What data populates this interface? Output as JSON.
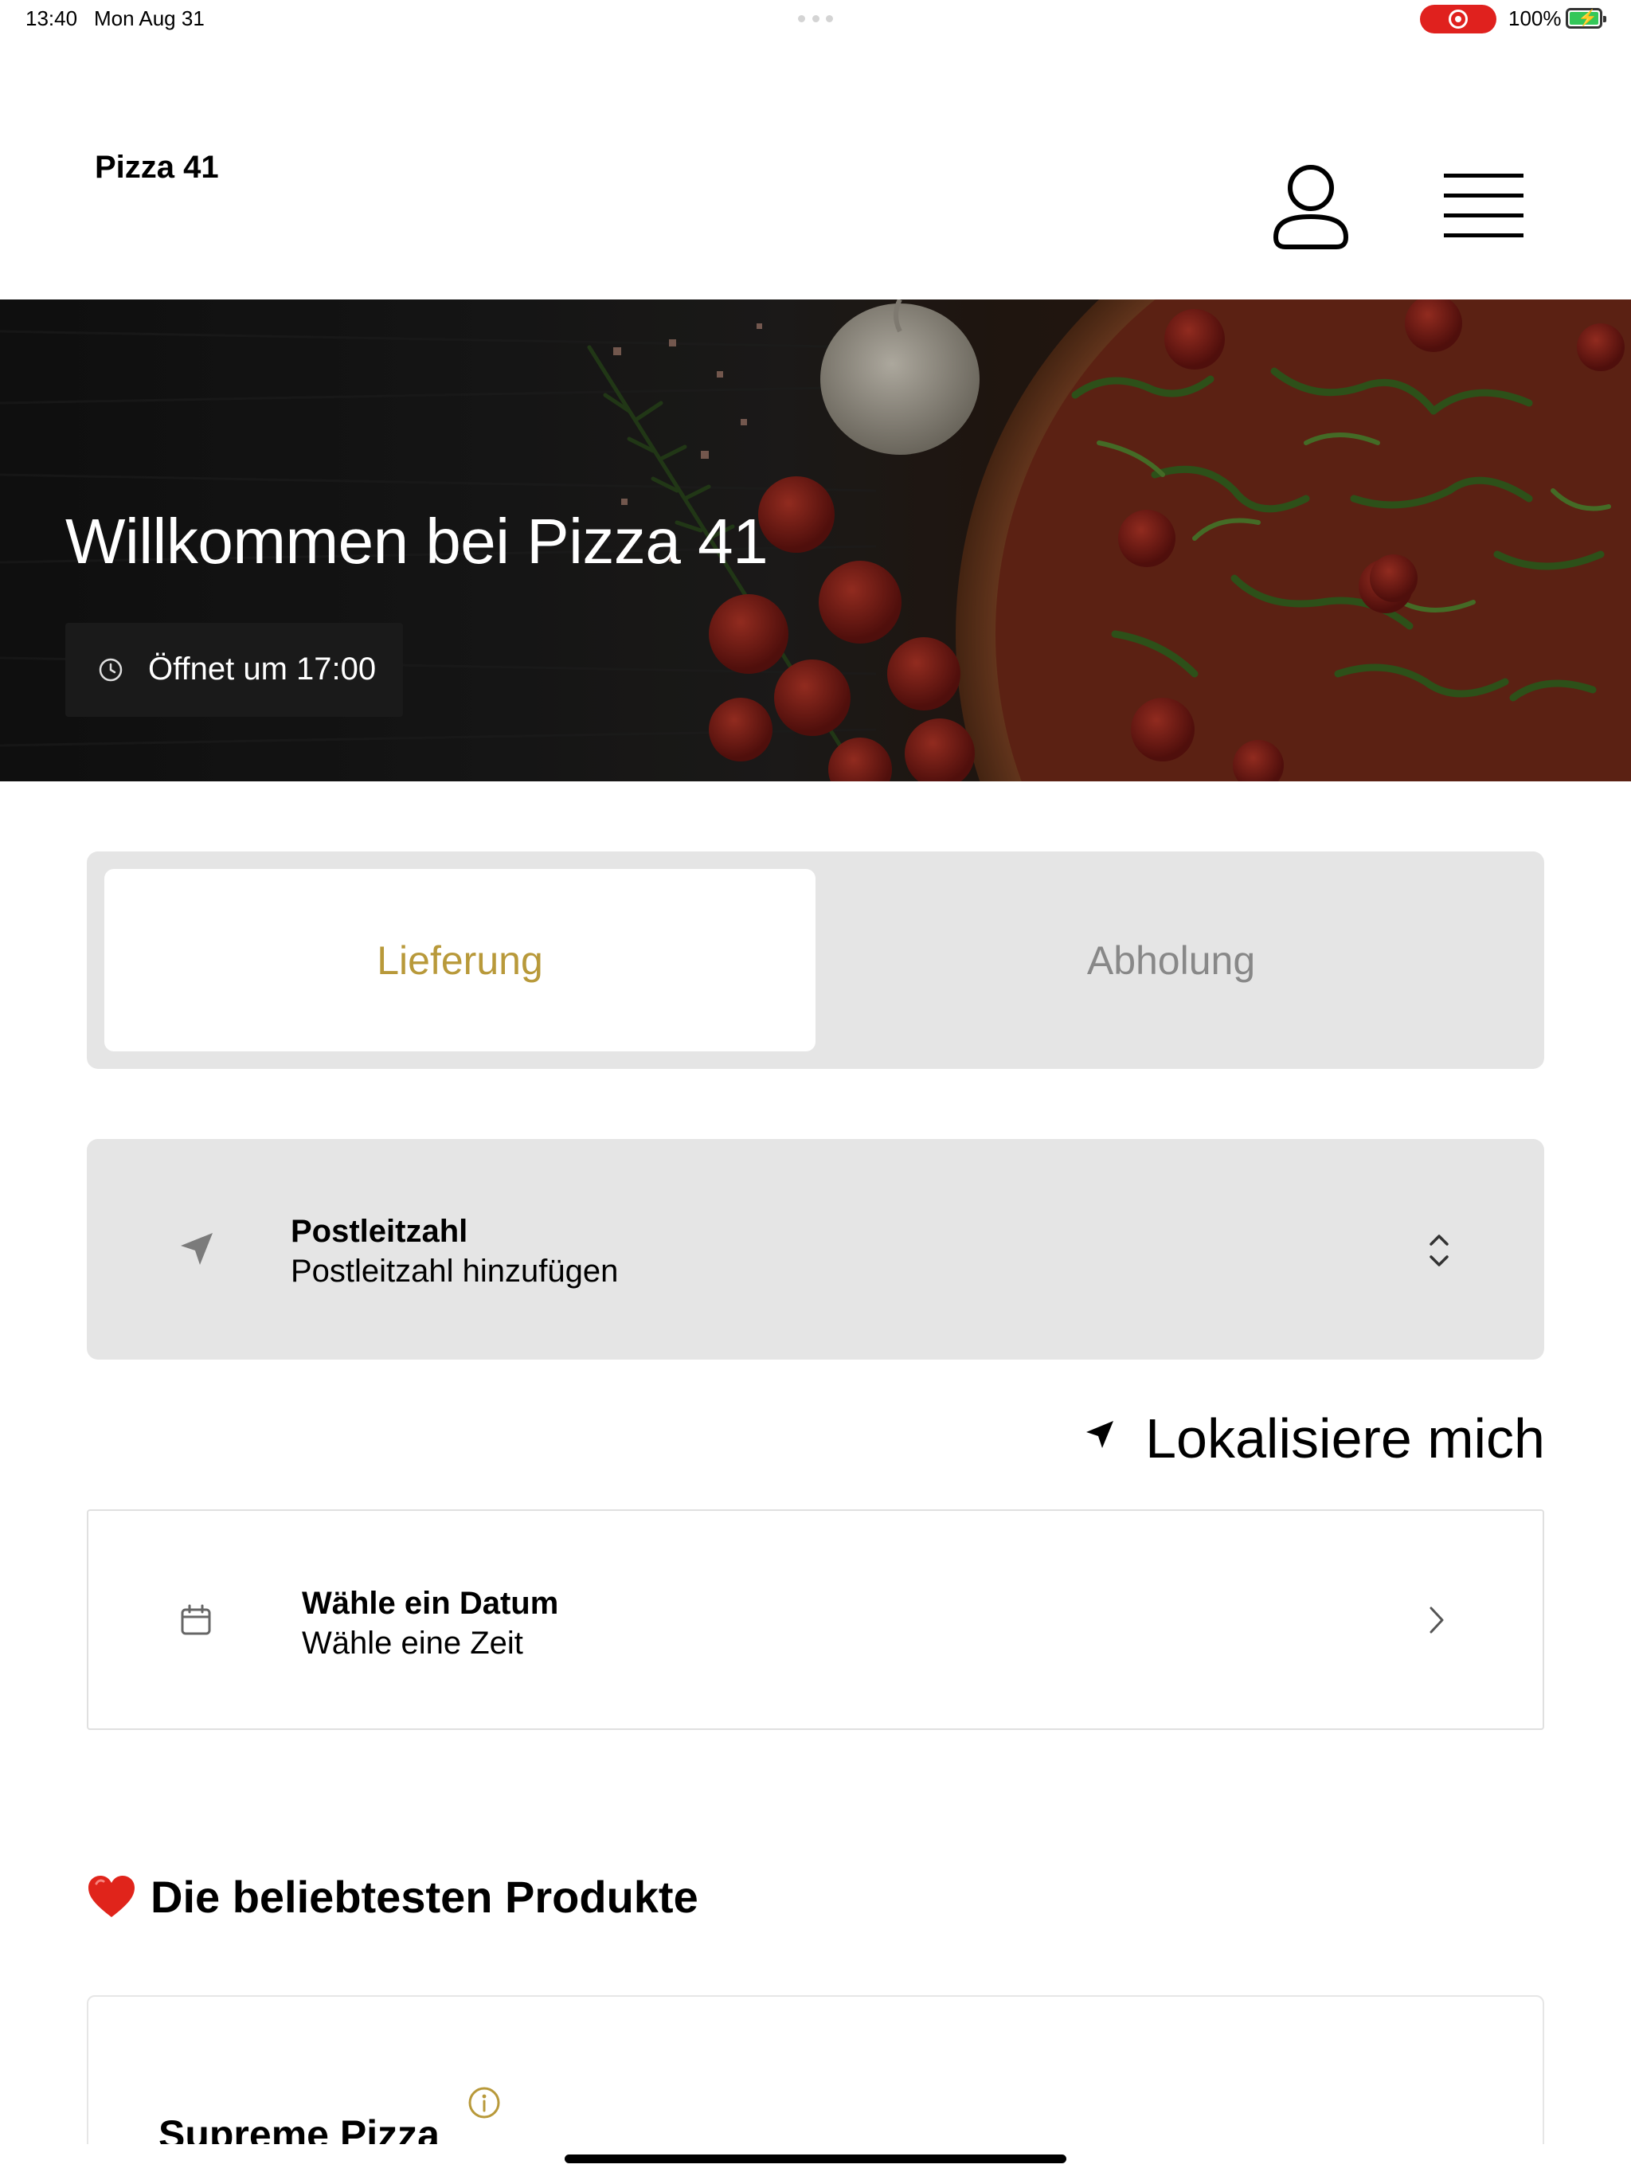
{
  "status_bar": {
    "time": "13:40",
    "date": "Mon Aug 31",
    "battery_percent": "100%",
    "battery_level": 1.0,
    "screen_recording": true,
    "recording_color": "#e0211e",
    "battery_color": "#34c759"
  },
  "header": {
    "brand": "Pizza 41",
    "profile_icon": "person-icon",
    "menu_icon": "hamburger-menu-icon"
  },
  "hero": {
    "title": "Willkommen bei Pizza 41",
    "hours_label": "Öffnet um 17:00",
    "hours_icon": "clock-icon"
  },
  "order_mode": {
    "tabs": [
      {
        "label": "Lieferung",
        "active": true
      },
      {
        "label": "Abholung",
        "active": false
      }
    ],
    "accent_color": "#b8993a"
  },
  "postal_code": {
    "title": "Postleitzahl",
    "placeholder": "Postleitzahl hinzufügen",
    "icon": "location-arrow-icon",
    "chevron_icon": "chevron-up-down-icon"
  },
  "locate": {
    "label": "Lokalisiere mich",
    "icon": "location-arrow-icon"
  },
  "schedule": {
    "title": "Wähle ein Datum",
    "subtitle": "Wähle eine Zeit",
    "icon": "calendar-icon",
    "chevron_icon": "chevron-right-icon"
  },
  "popular": {
    "heading": "Die beliebtesten Produkte",
    "heading_icon": "heart-icon",
    "products": [
      {
        "name": "Supreme Pizza",
        "info_icon": "info-icon"
      }
    ]
  }
}
